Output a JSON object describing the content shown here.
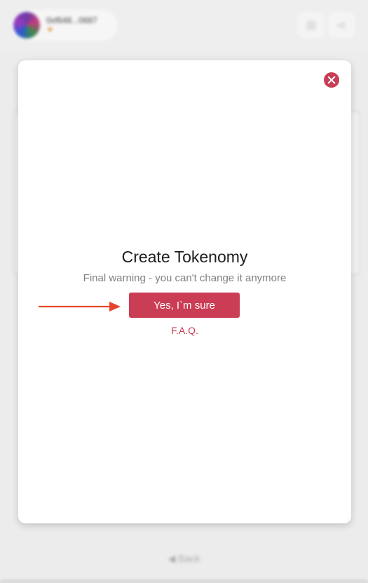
{
  "account": {
    "address": "0xf648...0687",
    "wallet_icon": "metamask-fox-icon"
  },
  "header_icons": [
    "cart-icon",
    "share-icon"
  ],
  "modal": {
    "title": "Create Tokenomy",
    "subtitle": "Final warning - you can't change it anymore",
    "confirm_label": "Yes, I`m sure",
    "faq_label": "F.A.Q.",
    "close_icon": "close-circle-icon"
  },
  "footer": {
    "back_label": "Back"
  },
  "colors": {
    "accent": "#cb3d55",
    "annotation_arrow": "#e8442b",
    "backdrop": "#ececec"
  }
}
